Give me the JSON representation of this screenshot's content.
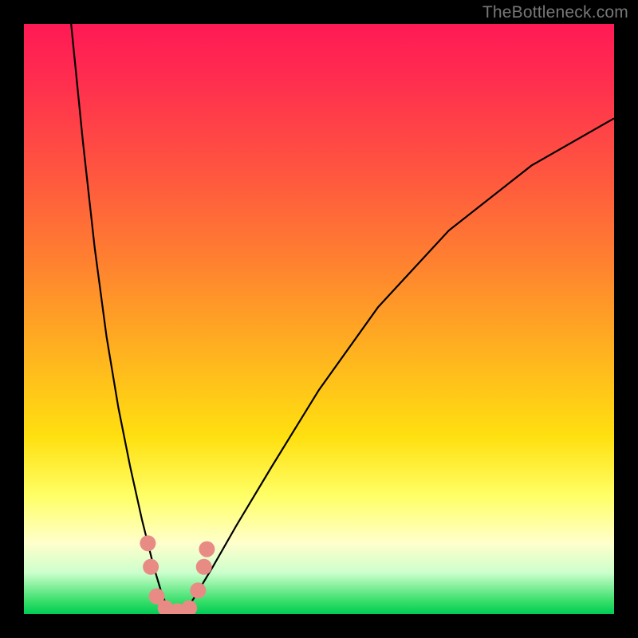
{
  "watermark": "TheBottleneck.com",
  "chart_data": {
    "type": "line",
    "title": "",
    "xlabel": "",
    "ylabel": "",
    "xlim": [
      0,
      100
    ],
    "ylim": [
      0,
      100
    ],
    "grid": false,
    "legend": false,
    "series": [
      {
        "name": "bottleneck-curve",
        "x": [
          8,
          10,
          12,
          14,
          16,
          18,
          20,
          22,
          23.5,
          25,
          27,
          29,
          32,
          36,
          42,
          50,
          60,
          72,
          86,
          100
        ],
        "values": [
          100,
          80,
          62,
          47,
          35,
          25,
          16,
          8,
          3,
          0,
          0,
          3,
          8,
          15,
          25,
          38,
          52,
          65,
          76,
          84
        ]
      }
    ],
    "markers": {
      "name": "highlight-dots",
      "points": [
        {
          "x": 21.0,
          "y": 12
        },
        {
          "x": 21.5,
          "y": 8
        },
        {
          "x": 22.5,
          "y": 3
        },
        {
          "x": 24.0,
          "y": 1
        },
        {
          "x": 26.0,
          "y": 0.5
        },
        {
          "x": 28.0,
          "y": 1
        },
        {
          "x": 29.5,
          "y": 4
        },
        {
          "x": 30.5,
          "y": 8
        },
        {
          "x": 31.0,
          "y": 11
        }
      ],
      "color": "#e98b85",
      "radius_px": 10
    },
    "gradient_stops": [
      {
        "pct": 0,
        "color": "#ff1a55"
      },
      {
        "pct": 25,
        "color": "#ff5540"
      },
      {
        "pct": 55,
        "color": "#ffb020"
      },
      {
        "pct": 80,
        "color": "#ffff66"
      },
      {
        "pct": 93,
        "color": "#ccffcc"
      },
      {
        "pct": 100,
        "color": "#00cc55"
      }
    ]
  }
}
